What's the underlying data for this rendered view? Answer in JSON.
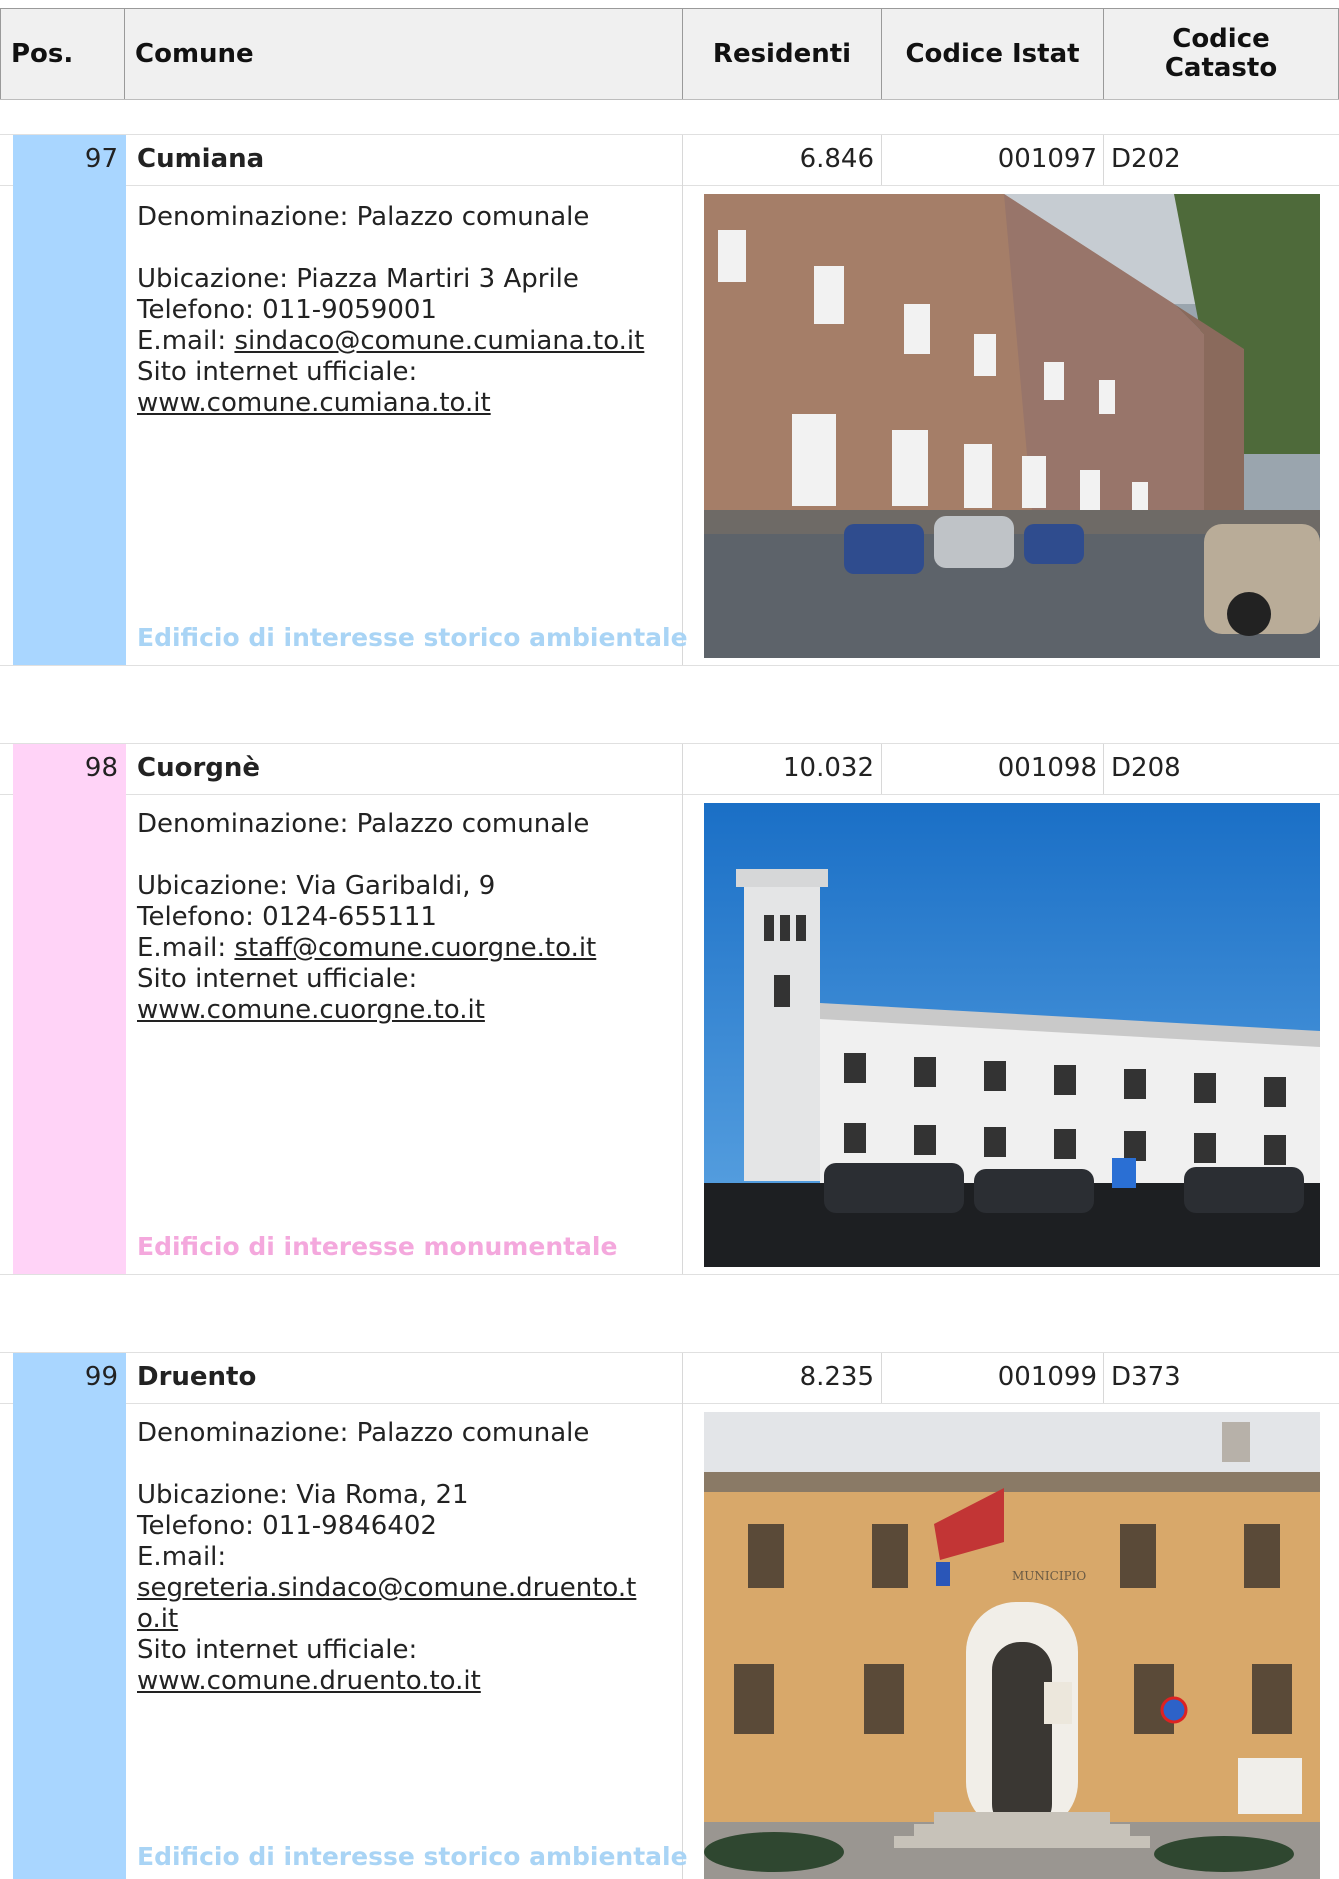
{
  "header": {
    "pos": "Pos.",
    "comune": "Comune",
    "residenti": "Residenti",
    "istat": "Codice Istat",
    "catasto_l1": "Codice",
    "catasto_l2": "Catasto"
  },
  "colors": {
    "blue_accent": "#a9d6ff",
    "pink_accent": "#ffd3f7",
    "blue_label": "#a9d4f5",
    "pink_label": "#f4a8dd"
  },
  "entries": [
    {
      "pos": "97",
      "name": "Cumiana",
      "residents": "6.846",
      "istat": "001097",
      "catasto": "D202",
      "denominazione": "Denominazione: Palazzo comunale",
      "ubicazione": "Ubicazione: Piazza Martiri 3 Aprile",
      "telefono": "Telefono: 011-9059001",
      "email_label": "E.mail:",
      "email": "sindaco@comune.cumiana.to.it",
      "sito_label": "Sito internet ufficiale:",
      "sito": "www.comune.cumiana.to.it",
      "category": "Edificio di interesse storico ambientale",
      "photo_icon": "town-hall-photo"
    },
    {
      "pos": "98",
      "name": "Cuorgnè",
      "residents": "10.032",
      "istat": "001098",
      "catasto": "D208",
      "denominazione": "Denominazione: Palazzo comunale",
      "ubicazione": "Ubicazione: Via Garibaldi, 9",
      "telefono": "Telefono: 0124-655111",
      "email_label": "E.mail:",
      "email": "staff@comune.cuorgne.to.it",
      "sito_label": "Sito internet ufficiale:",
      "sito": "www.comune.cuorgne.to.it",
      "category": "Edificio di interesse monumentale",
      "photo_icon": "town-hall-photo"
    },
    {
      "pos": "99",
      "name": "Druento",
      "residents": "8.235",
      "istat": "001099",
      "catasto": "D373",
      "denominazione": "Denominazione: Palazzo comunale",
      "ubicazione": "Ubicazione: Via Roma, 21",
      "telefono": "Telefono: 011-9846402",
      "email_label": "E.mail:",
      "email_l1": "segreteria.sindaco@comune.druento.t",
      "email_l2": "o.it",
      "sito_label": "Sito internet ufficiale:",
      "sito": "www.comune.druento.to.it",
      "category": "Edificio di interesse storico ambientale",
      "photo_sign": "MUNICIPIO",
      "photo_icon": "town-hall-photo"
    }
  ]
}
